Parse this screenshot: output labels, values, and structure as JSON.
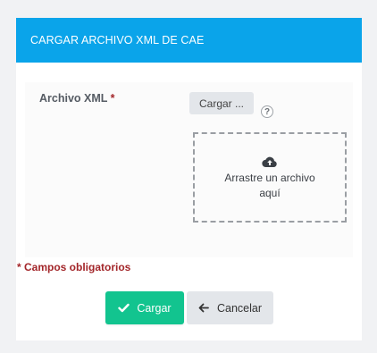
{
  "header": {
    "title": "CARGAR ARCHIVO XML DE CAE"
  },
  "form": {
    "field_label": "Archivo XML",
    "required_marker": "*",
    "upload_button_label": "Cargar ...",
    "help_icon": "?",
    "dropzone": {
      "icon": "cloud-upload-icon",
      "text": "Arrastre un archivo aquí"
    }
  },
  "required_note": "* Campos obligatorios",
  "actions": {
    "submit_label": "Cargar",
    "cancel_label": "Cancelar"
  },
  "colors": {
    "header_bg": "#0aa4ea",
    "primary_button": "#12c48f",
    "required_text": "#a3262a",
    "secondary_button": "#e3e6ea"
  }
}
